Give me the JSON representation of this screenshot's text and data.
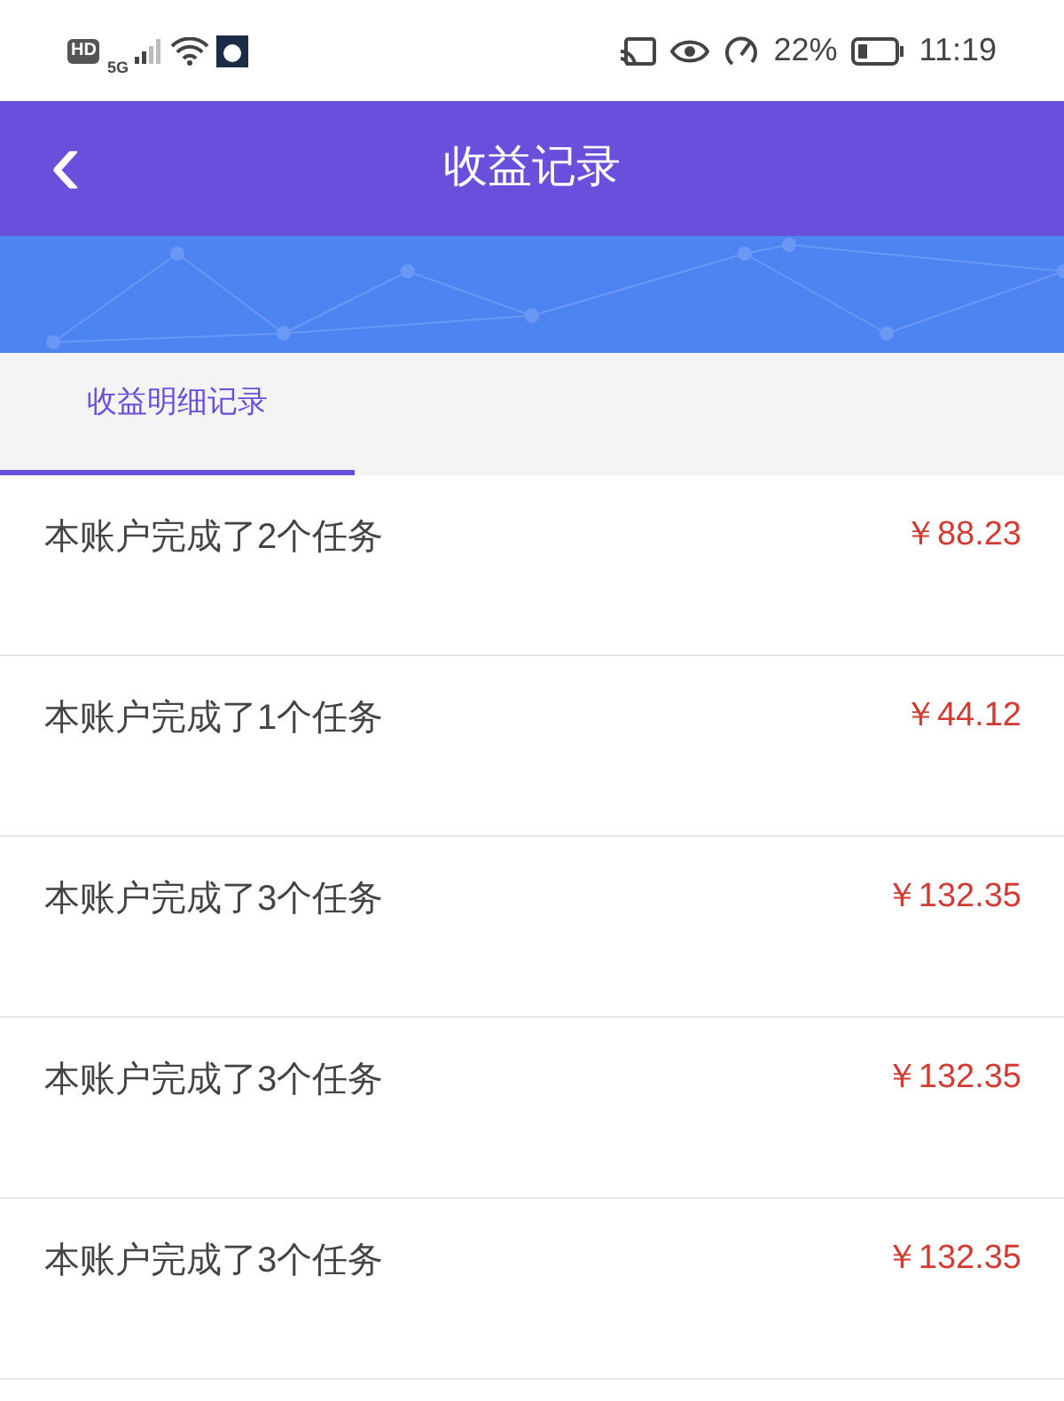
{
  "status_bar": {
    "network_badge": "HD",
    "network_type": "5G",
    "battery_percent": "22%",
    "time": "11:19"
  },
  "header": {
    "back_glyph": "‹",
    "title": "收益记录"
  },
  "tabs": [
    {
      "label": "收益明细记录",
      "selected": true
    }
  ],
  "records": [
    {
      "description": "本账户完成了2个任务",
      "amount": "￥88.23"
    },
    {
      "description": "本账户完成了1个任务",
      "amount": "￥44.12"
    },
    {
      "description": "本账户完成了3个任务",
      "amount": "￥132.35"
    },
    {
      "description": "本账户完成了3个任务",
      "amount": "￥132.35"
    },
    {
      "description": "本账户完成了3个任务",
      "amount": "￥132.35"
    }
  ]
}
